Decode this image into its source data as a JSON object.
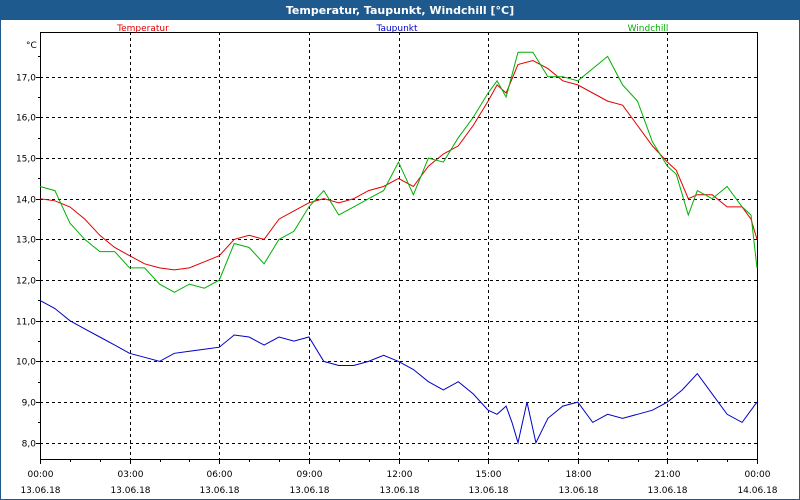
{
  "window": {
    "title": "Temperatur, Taupunkt, Windchill [°C]"
  },
  "chart_data": {
    "type": "line",
    "title": "Temperatur, Taupunkt, Windchill [°C]",
    "ylabel": "°C",
    "xlabel": "",
    "ylim": [
      7.6,
      18.1
    ],
    "xlim": [
      0,
      24
    ],
    "grid": true,
    "legend_placement": "top",
    "y_ticks": [
      "8,0",
      "9,0",
      "10,0",
      "11,0",
      "12,0",
      "13,0",
      "14,0",
      "15,0",
      "16,0",
      "17,0"
    ],
    "x_ticks": [
      {
        "time": "00:00",
        "date": "13.06.18",
        "x": 0
      },
      {
        "time": "03:00",
        "date": "13.06.18",
        "x": 3
      },
      {
        "time": "06:00",
        "date": "13.06.18",
        "x": 6
      },
      {
        "time": "09:00",
        "date": "13.06.18",
        "x": 9
      },
      {
        "time": "12:00",
        "date": "13.06.18",
        "x": 12
      },
      {
        "time": "15:00",
        "date": "13.06.18",
        "x": 15
      },
      {
        "time": "18:00",
        "date": "13.06.18",
        "x": 18
      },
      {
        "time": "21:00",
        "date": "13.06.18",
        "x": 21
      },
      {
        "time": "00:00",
        "date": "14.06.18",
        "x": 24
      }
    ],
    "series": [
      {
        "name": "Temperatur",
        "color": "#e00000",
        "points": [
          [
            0,
            14.0
          ],
          [
            0.5,
            13.95
          ],
          [
            1,
            13.8
          ],
          [
            1.5,
            13.5
          ],
          [
            2,
            13.1
          ],
          [
            2.5,
            12.8
          ],
          [
            3,
            12.6
          ],
          [
            3.5,
            12.4
          ],
          [
            4,
            12.3
          ],
          [
            4.5,
            12.25
          ],
          [
            5,
            12.3
          ],
          [
            5.5,
            12.45
          ],
          [
            6,
            12.6
          ],
          [
            6.5,
            13.0
          ],
          [
            7,
            13.1
          ],
          [
            7.5,
            13.0
          ],
          [
            8,
            13.5
          ],
          [
            8.5,
            13.7
          ],
          [
            9,
            13.9
          ],
          [
            9.5,
            14.0
          ],
          [
            10,
            13.9
          ],
          [
            10.5,
            14.0
          ],
          [
            11,
            14.2
          ],
          [
            11.5,
            14.3
          ],
          [
            12,
            14.5
          ],
          [
            12.5,
            14.3
          ],
          [
            13,
            14.8
          ],
          [
            13.5,
            15.1
          ],
          [
            14,
            15.3
          ],
          [
            14.5,
            15.8
          ],
          [
            15,
            16.4
          ],
          [
            15.3,
            16.8
          ],
          [
            15.6,
            16.6
          ],
          [
            16,
            17.3
          ],
          [
            16.5,
            17.4
          ],
          [
            17,
            17.2
          ],
          [
            17.5,
            16.9
          ],
          [
            18,
            16.8
          ],
          [
            18.5,
            16.6
          ],
          [
            19,
            16.4
          ],
          [
            19.5,
            16.3
          ],
          [
            20,
            15.8
          ],
          [
            20.5,
            15.3
          ],
          [
            21,
            14.9
          ],
          [
            21.3,
            14.7
          ],
          [
            21.7,
            14.0
          ],
          [
            22,
            14.1
          ],
          [
            22.5,
            14.1
          ],
          [
            23,
            13.8
          ],
          [
            23.5,
            13.8
          ],
          [
            23.8,
            13.5
          ],
          [
            24,
            13.0
          ]
        ]
      },
      {
        "name": "Taupunkt",
        "color": "#0000c8",
        "points": [
          [
            0,
            11.5
          ],
          [
            0.5,
            11.3
          ],
          [
            1,
            11.0
          ],
          [
            1.5,
            10.8
          ],
          [
            2,
            10.6
          ],
          [
            2.5,
            10.4
          ],
          [
            3,
            10.2
          ],
          [
            3.5,
            10.1
          ],
          [
            4,
            10.0
          ],
          [
            4.5,
            10.2
          ],
          [
            5,
            10.25
          ],
          [
            5.5,
            10.3
          ],
          [
            6,
            10.35
          ],
          [
            6.5,
            10.65
          ],
          [
            7,
            10.6
          ],
          [
            7.5,
            10.4
          ],
          [
            8,
            10.6
          ],
          [
            8.5,
            10.5
          ],
          [
            9,
            10.6
          ],
          [
            9.5,
            10.0
          ],
          [
            10,
            9.9
          ],
          [
            10.5,
            9.9
          ],
          [
            11,
            10.0
          ],
          [
            11.5,
            10.15
          ],
          [
            12,
            10.0
          ],
          [
            12.5,
            9.8
          ],
          [
            13,
            9.5
          ],
          [
            13.5,
            9.3
          ],
          [
            14,
            9.5
          ],
          [
            14.5,
            9.2
          ],
          [
            15,
            8.8
          ],
          [
            15.3,
            8.7
          ],
          [
            15.6,
            8.9
          ],
          [
            15.8,
            8.5
          ],
          [
            16,
            8.0
          ],
          [
            16.3,
            9.0
          ],
          [
            16.6,
            8.0
          ],
          [
            17,
            8.6
          ],
          [
            17.5,
            8.9
          ],
          [
            18,
            9.0
          ],
          [
            18.5,
            8.5
          ],
          [
            19,
            8.7
          ],
          [
            19.5,
            8.6
          ],
          [
            20,
            8.7
          ],
          [
            20.5,
            8.8
          ],
          [
            21,
            9.0
          ],
          [
            21.5,
            9.3
          ],
          [
            22,
            9.7
          ],
          [
            22.5,
            9.2
          ],
          [
            23,
            8.7
          ],
          [
            23.5,
            8.5
          ],
          [
            24,
            9.0
          ]
        ]
      },
      {
        "name": "Windchill",
        "color": "#00b000",
        "points": [
          [
            0,
            14.3
          ],
          [
            0.5,
            14.2
          ],
          [
            1,
            13.4
          ],
          [
            1.5,
            13.0
          ],
          [
            2,
            12.7
          ],
          [
            2.5,
            12.7
          ],
          [
            3,
            12.3
          ],
          [
            3.5,
            12.3
          ],
          [
            4,
            11.9
          ],
          [
            4.5,
            11.7
          ],
          [
            5,
            11.9
          ],
          [
            5.5,
            11.8
          ],
          [
            6,
            12.0
          ],
          [
            6.5,
            12.9
          ],
          [
            7,
            12.8
          ],
          [
            7.5,
            12.4
          ],
          [
            8,
            13.0
          ],
          [
            8.5,
            13.2
          ],
          [
            9,
            13.8
          ],
          [
            9.5,
            14.2
          ],
          [
            10,
            13.6
          ],
          [
            10.5,
            13.8
          ],
          [
            11,
            14.0
          ],
          [
            11.5,
            14.2
          ],
          [
            12,
            14.9
          ],
          [
            12.5,
            14.1
          ],
          [
            13,
            15.0
          ],
          [
            13.5,
            14.9
          ],
          [
            14,
            15.5
          ],
          [
            14.5,
            16.0
          ],
          [
            15,
            16.6
          ],
          [
            15.3,
            16.9
          ],
          [
            15.6,
            16.5
          ],
          [
            16,
            17.6
          ],
          [
            16.5,
            17.6
          ],
          [
            17,
            17.0
          ],
          [
            17.5,
            17.0
          ],
          [
            18,
            16.9
          ],
          [
            18.5,
            17.2
          ],
          [
            19,
            17.5
          ],
          [
            19.5,
            16.8
          ],
          [
            20,
            16.4
          ],
          [
            20.5,
            15.4
          ],
          [
            21,
            14.8
          ],
          [
            21.3,
            14.6
          ],
          [
            21.7,
            13.6
          ],
          [
            22,
            14.2
          ],
          [
            22.5,
            14.0
          ],
          [
            23,
            14.3
          ],
          [
            23.5,
            13.8
          ],
          [
            23.8,
            13.6
          ],
          [
            24,
            12.3
          ]
        ]
      }
    ]
  }
}
